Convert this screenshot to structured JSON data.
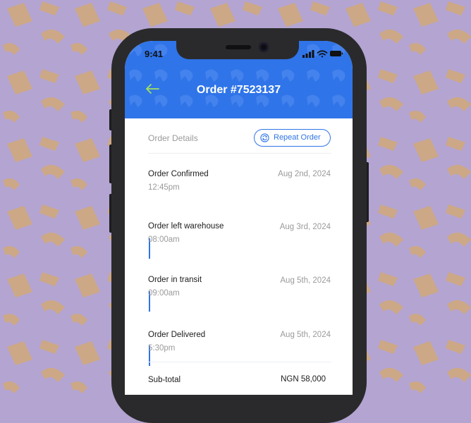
{
  "status_bar": {
    "time": "9:41"
  },
  "header": {
    "title": "Order #7523137"
  },
  "details": {
    "label": "Order Details",
    "repeat_button": "Repeat Order"
  },
  "timeline": [
    {
      "title": "Order Confirmed",
      "time": "12:45pm",
      "date": "Aug 2nd, 2024"
    },
    {
      "title": "Order left warehouse",
      "time": "08:00am",
      "date": "Aug 3rd, 2024"
    },
    {
      "title": "Order in transit",
      "time": "09:00am",
      "date": "Aug 5th, 2024"
    },
    {
      "title": "Order Delivered",
      "time": "5:30pm",
      "date": "Aug 5th, 2024"
    }
  ],
  "summary": {
    "subtotal_label": "Sub-total",
    "subtotal_value": "NGN 58,000"
  },
  "colors": {
    "accent": "#2f74e8",
    "back_arrow": "#a4e15a",
    "background": "#b3a4d1",
    "pattern": "#cda886"
  }
}
